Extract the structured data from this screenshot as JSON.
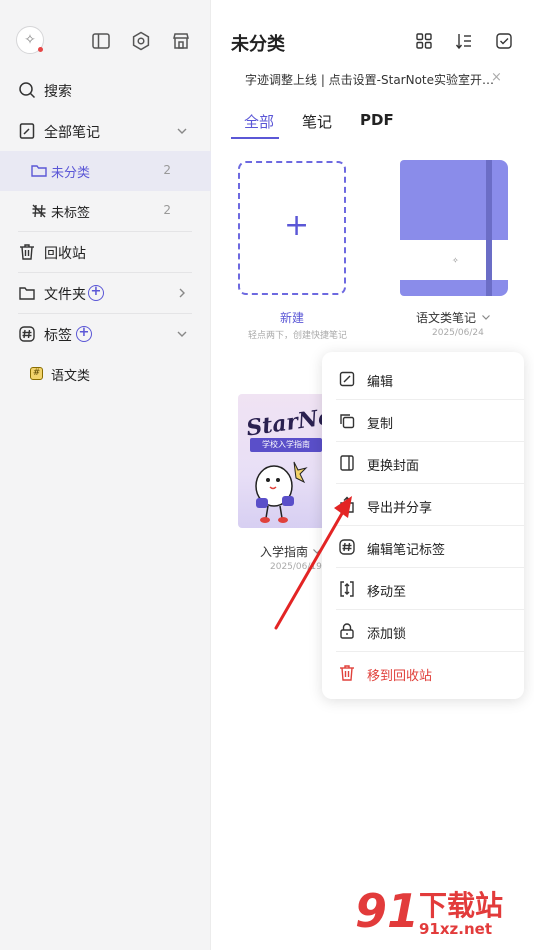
{
  "sidebar": {
    "items": [
      {
        "label": "搜索"
      },
      {
        "label": "全部笔记"
      },
      {
        "label": "未分类",
        "count": "2"
      },
      {
        "label": "未标签",
        "count": "2"
      },
      {
        "label": "回收站"
      },
      {
        "label": "文件夹"
      },
      {
        "label": "标签"
      },
      {
        "label": "语文类",
        "tag_glyph": "#"
      }
    ]
  },
  "main": {
    "title": "未分类",
    "notice": "字迹调整上线 | 点击设置-StarNote实验室开…",
    "notice_close": "×",
    "tabs": [
      {
        "label": "全部"
      },
      {
        "label": "笔记"
      },
      {
        "label": "PDF"
      }
    ],
    "cards": [
      {
        "title": "新建",
        "sub": "轻点两下，创建快捷笔记",
        "plus": "+"
      },
      {
        "title": "语文类笔记",
        "sub": "2025/06/24"
      },
      {
        "title": "入学指南",
        "sub": "2025/06/19",
        "cover_logo": "StarNote",
        "cover_banner": "学校入学指南"
      }
    ]
  },
  "context_menu": {
    "items": [
      {
        "label": "编辑"
      },
      {
        "label": "复制"
      },
      {
        "label": "更换封面"
      },
      {
        "label": "导出并分享"
      },
      {
        "label": "编辑笔记标签"
      },
      {
        "label": "移动至"
      },
      {
        "label": "添加锁"
      },
      {
        "label": "移到回收站"
      }
    ]
  },
  "watermark": {
    "brand": "91",
    "name": "下载站",
    "url": "91xz.net"
  },
  "colors": {
    "accent": "#5b57d6",
    "danger": "#e0413b",
    "arrow": "#e32424"
  }
}
